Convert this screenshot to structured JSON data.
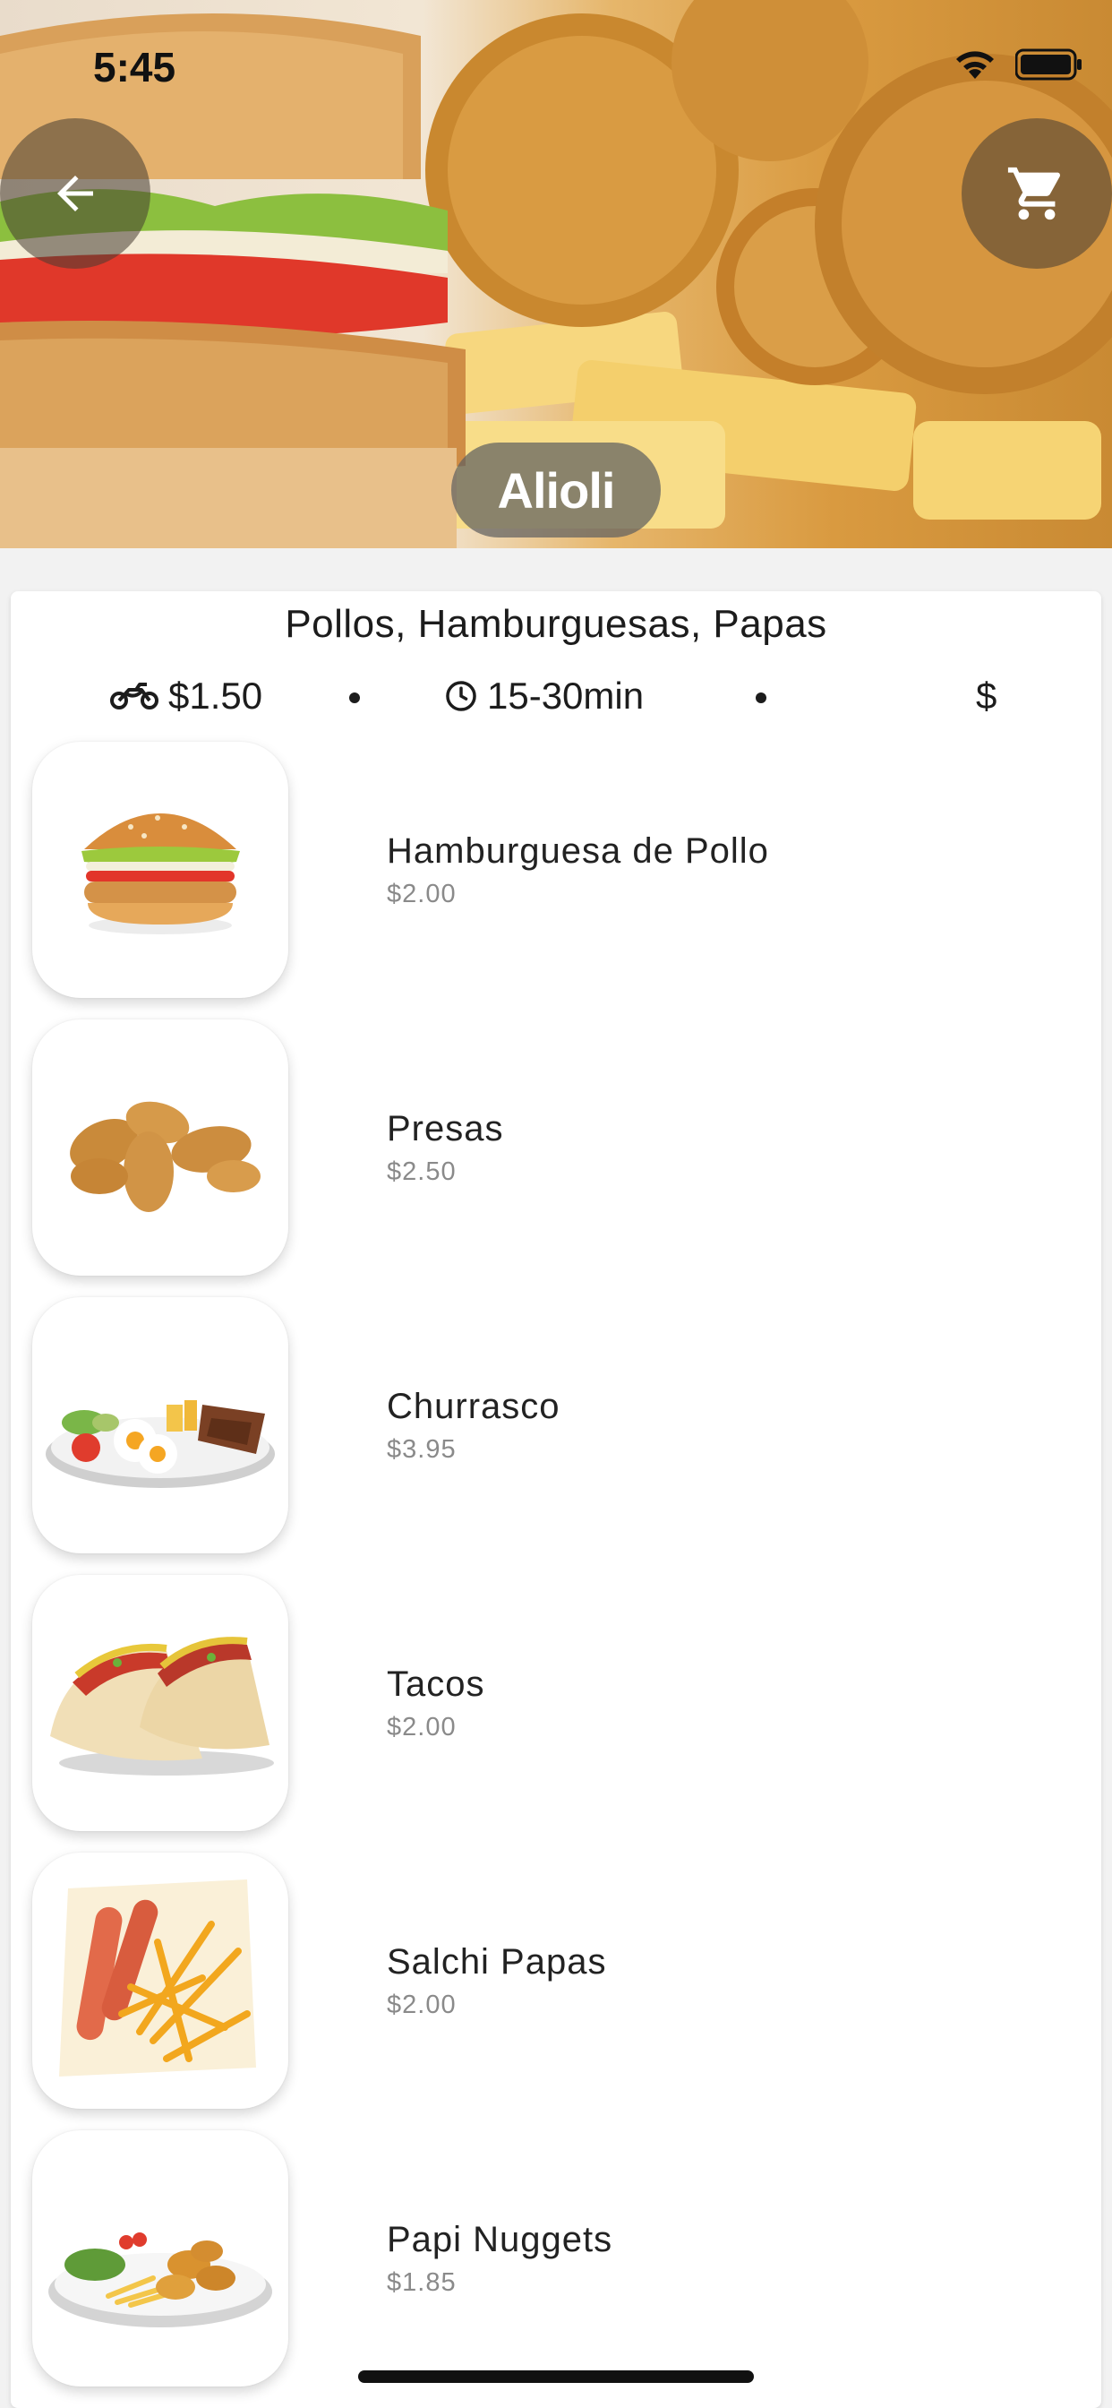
{
  "status_bar": {
    "time": "5:45"
  },
  "store": {
    "name": "Alioli",
    "categories": "Pollos, Hamburguesas, Papas",
    "delivery_fee": "$1.50",
    "delivery_time": "15-30min",
    "price_level": "$"
  },
  "menu": [
    {
      "name": "Hamburguesa de Pollo",
      "price": "$2.00",
      "icon": "chicken-burger"
    },
    {
      "name": "Presas",
      "price": "$2.50",
      "icon": "fried-chicken"
    },
    {
      "name": "Churrasco",
      "price": "$3.95",
      "icon": "churrasco-plate"
    },
    {
      "name": "Tacos",
      "price": "$2.00",
      "icon": "tacos"
    },
    {
      "name": "Salchi Papas",
      "price": "$2.00",
      "icon": "sausage-fries"
    },
    {
      "name": "Papi Nuggets",
      "price": "$1.85",
      "icon": "nuggets-plate"
    }
  ],
  "icons": {
    "back": "arrow-left-icon",
    "cart": "shopping-cart-icon",
    "delivery": "motorcycle-icon",
    "time": "clock-icon",
    "wifi": "wifi-icon",
    "battery": "battery-icon"
  }
}
